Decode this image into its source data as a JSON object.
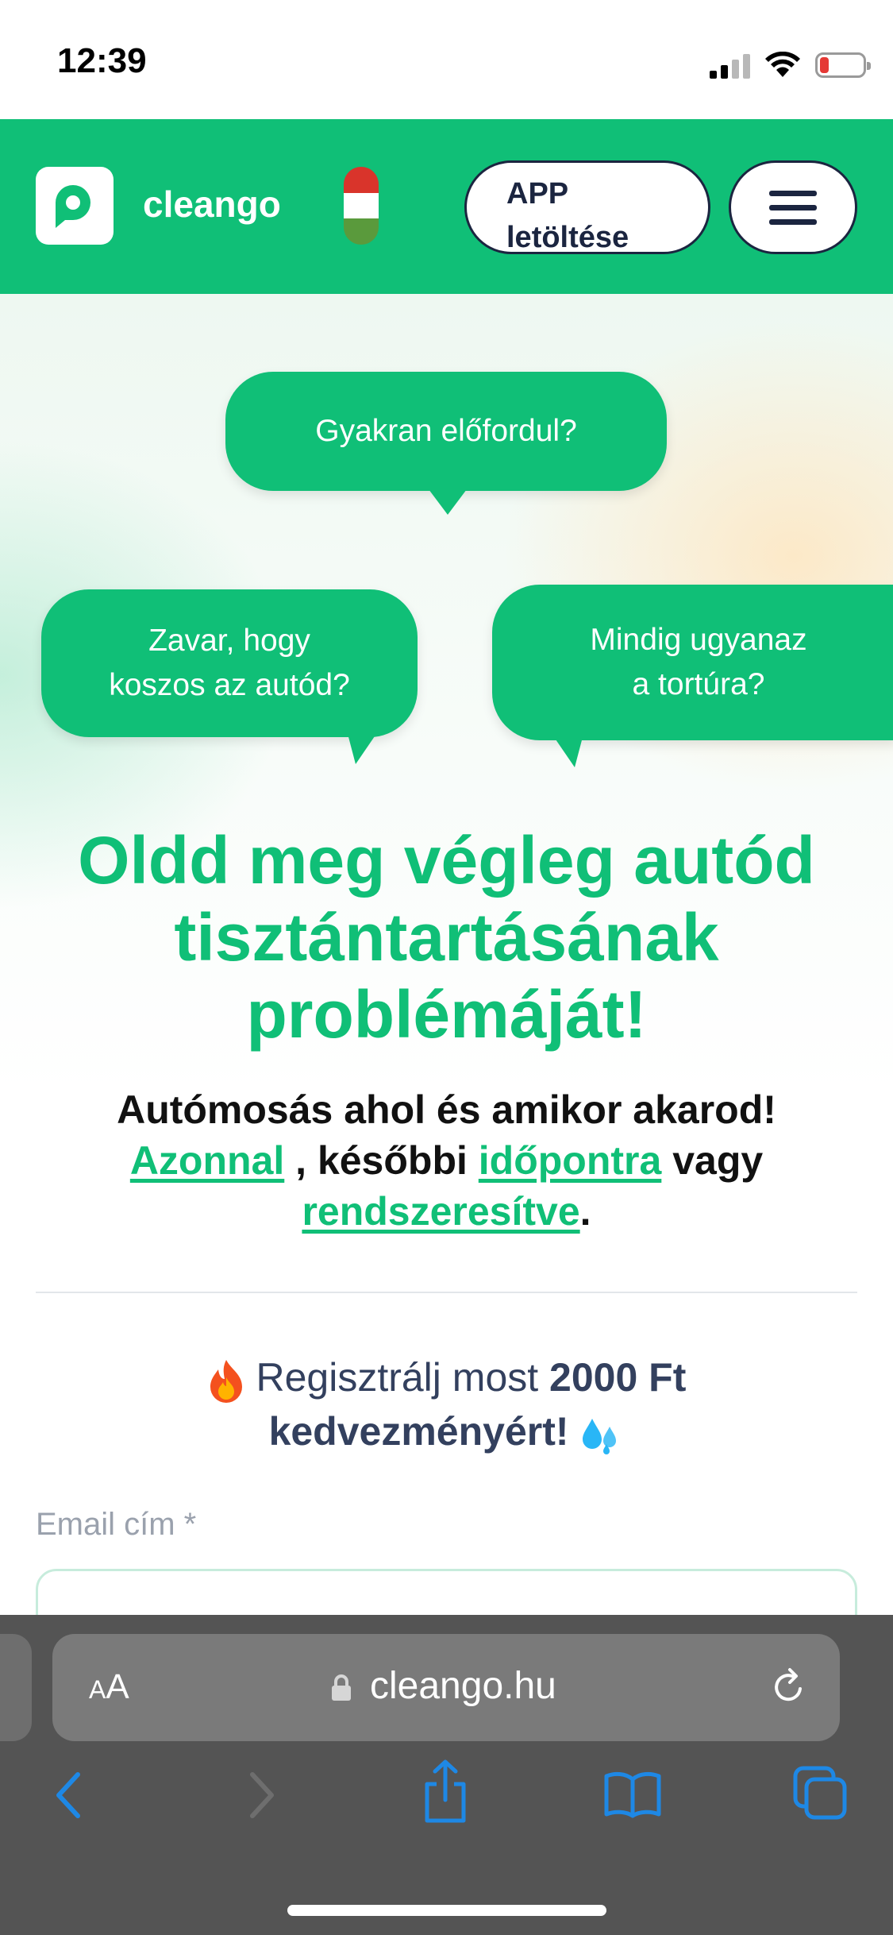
{
  "status": {
    "time": "12:39",
    "icons": [
      "signal-icon",
      "wifi-icon",
      "battery-low-icon"
    ]
  },
  "header": {
    "brand": "cleango",
    "app_button_line1": "APP",
    "app_button_line2": "letöltése",
    "icons": [
      "cleango-logo",
      "hungary-flag-icon",
      "hamburger-menu-icon"
    ],
    "colors": {
      "primary": "#10bf77",
      "dark": "#1b2540"
    }
  },
  "hero": {
    "bubble_top": "Gyakran előfordul?",
    "bubble_left_line1": "Zavar, hogy",
    "bubble_left_line2": "koszos az autód?",
    "bubble_right_line1": "Mindig ugyanaz",
    "bubble_right_line2": "a tortúra?",
    "title_line1": "Oldd meg végleg autód",
    "title_line2": "tisztántartásának",
    "title_line3": "problémáját!",
    "subtitle_line1": "Autómosás ahol és amikor akarod!",
    "link_now": "Azonnal",
    "text_later": " , későbbi ",
    "link_appointment": "időpontra",
    "text_or": " vagy",
    "link_regular": "rendszeresítve",
    "text_period": "."
  },
  "promo": {
    "text_before": " Regisztrálj most ",
    "amount": "2000 Ft",
    "text_bold2": "kedvezményért!",
    "icons": [
      "fire-icon",
      "water-drops-icon"
    ]
  },
  "form": {
    "email_label": "Email cím *",
    "email_value": ""
  },
  "browser": {
    "aa_small": "A",
    "aa_large": "A",
    "url": "cleango.hu",
    "icons": [
      "lock-icon",
      "reload-icon",
      "back-icon",
      "forward-icon",
      "share-icon",
      "bookmarks-icon",
      "tabs-icon"
    ]
  }
}
